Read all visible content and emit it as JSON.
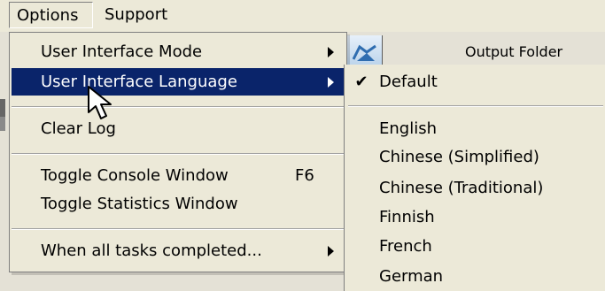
{
  "menubar": {
    "items": [
      {
        "label": "Options"
      },
      {
        "label": "Support"
      }
    ]
  },
  "background": {
    "output_folder_label": "Output Folder"
  },
  "options_menu": {
    "items": [
      {
        "label": "User Interface Mode",
        "has_submenu": true
      },
      {
        "label": "User Interface Language",
        "has_submenu": true,
        "selected": true
      },
      {
        "label": "Clear Log"
      },
      {
        "label": "Toggle Console Window",
        "shortcut": "F6"
      },
      {
        "label": "Toggle Statistics Window"
      },
      {
        "label": "When all tasks completed...",
        "has_submenu": true
      }
    ]
  },
  "language_submenu": {
    "items": [
      {
        "label": "Default",
        "checked": true
      },
      {
        "label": "English"
      },
      {
        "label": "Chinese (Simplified)"
      },
      {
        "label": "Chinese (Traditional)"
      },
      {
        "label": "Finnish"
      },
      {
        "label": "French"
      },
      {
        "label": "German"
      }
    ]
  },
  "colors": {
    "menu_background": "#ece9d8",
    "selection_background": "#0a246a",
    "selection_text": "#ffffff",
    "separator": "#a0a0a0"
  },
  "icons": {
    "submenu_arrow": "chevron-right-icon",
    "checked": "checkmark-icon",
    "cursor": "mouse-pointer-icon",
    "folder": "folder-icon"
  }
}
